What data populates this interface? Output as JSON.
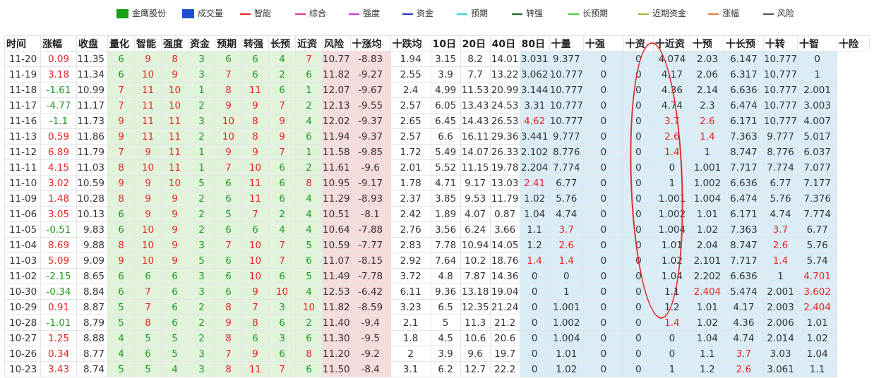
{
  "legend": [
    {
      "label": "金鹰股份",
      "color": "#16a116",
      "style": "box",
      "icon": "green-square"
    },
    {
      "label": "成交量",
      "color": "#1f4fd1",
      "style": "box",
      "icon": "blue-square"
    },
    {
      "label": "智能",
      "color": "#e5262a",
      "style": "line",
      "icon": "red-line"
    },
    {
      "label": "综合",
      "color": "#e0368c",
      "style": "line",
      "icon": "pink-line"
    },
    {
      "label": "强度",
      "color": "#d832d8",
      "style": "line",
      "icon": "magenta-line"
    },
    {
      "label": "资金",
      "color": "#2432c4",
      "style": "line",
      "icon": "navy-line"
    },
    {
      "label": "预期",
      "color": "#32d6d0",
      "style": "line",
      "icon": "cyan-line"
    },
    {
      "label": "转强",
      "color": "#1a6e1a",
      "style": "line",
      "icon": "darkgreen-line"
    },
    {
      "label": "长预期",
      "color": "#3fd63f",
      "style": "line",
      "icon": "lime-line"
    },
    {
      "label": "近期资金",
      "color": "#b4ad2e",
      "style": "line",
      "icon": "olive-line"
    },
    {
      "label": "涨幅",
      "color": "#ef7a3c",
      "style": "line",
      "icon": "orange-line"
    },
    {
      "label": "风险",
      "color": "#6b4a3c",
      "style": "line",
      "icon": "brown-line"
    }
  ],
  "columns": [
    "时间",
    "涨幅",
    "收盘",
    "量化",
    "智能",
    "强度",
    "资金",
    "预期",
    "转强",
    "长预",
    "近资",
    "风险",
    "十涨均",
    "十跌均",
    "10日",
    "20日",
    "40日",
    "80日",
    "十量",
    "十强",
    "十资",
    "十近资",
    "十预",
    "十长预",
    "十转",
    "十智",
    "十险"
  ],
  "rows": [
    {
      "date": "11-20",
      "chg": "0.09",
      "close": "11.35",
      "m": [
        "6",
        "9",
        "8",
        "3",
        "6",
        "6",
        "4",
        "7"
      ],
      "up10": "10.77",
      "dn10": "-8.83",
      "d": [
        "1.94",
        "3.15",
        "8.2",
        "14.01"
      ],
      "t": [
        "3.031",
        "9.377",
        "0",
        "0",
        "4.074",
        "2.03",
        "6.147",
        "10.777",
        "0"
      ],
      "tr": []
    },
    {
      "date": "11-19",
      "chg": "3.18",
      "close": "11.34",
      "m": [
        "6",
        "10",
        "9",
        "3",
        "7",
        "6",
        "2",
        "6"
      ],
      "up10": "11.82",
      "dn10": "-9.27",
      "d": [
        "2.55",
        "3.9",
        "7.7",
        "13.22"
      ],
      "t": [
        "3.062",
        "10.777",
        "0",
        "0",
        "4.17",
        "2.06",
        "6.317",
        "10.777",
        "1"
      ],
      "tr": []
    },
    {
      "date": "11-18",
      "chg": "-1.61",
      "close": "10.99",
      "m": [
        "7",
        "11",
        "10",
        "1",
        "8",
        "11",
        "6",
        "1"
      ],
      "up10": "12.07",
      "dn10": "-9.67",
      "d": [
        "2.4",
        "4.99",
        "11.53",
        "20.99"
      ],
      "t": [
        "3.144",
        "10.777",
        "0",
        "0",
        "4.36",
        "2.14",
        "6.636",
        "10.777",
        "2.001"
      ],
      "tr": []
    },
    {
      "date": "11-17",
      "chg": "-4.77",
      "close": "11.17",
      "m": [
        "7",
        "11",
        "10",
        "2",
        "9",
        "9",
        "7",
        "2"
      ],
      "up10": "12.13",
      "dn10": "-9.55",
      "d": [
        "2.57",
        "6.05",
        "13.43",
        "24.53"
      ],
      "t": [
        "3.31",
        "10.777",
        "0",
        "0",
        "4.74",
        "2.3",
        "6.474",
        "10.777",
        "3.003"
      ],
      "tr": []
    },
    {
      "date": "11-16",
      "chg": "-1.1",
      "close": "11.73",
      "m": [
        "9",
        "11",
        "11",
        "3",
        "10",
        "8",
        "9",
        "4"
      ],
      "up10": "12.02",
      "dn10": "-9.37",
      "d": [
        "2.65",
        "6.45",
        "14.43",
        "26.53"
      ],
      "t": [
        "4.62",
        "10.777",
        "0",
        "0",
        "3.7",
        "2.6",
        "6.171",
        "10.777",
        "4.007"
      ],
      "tr": [
        0,
        4,
        5
      ]
    },
    {
      "date": "11-13",
      "chg": "0.59",
      "close": "11.86",
      "m": [
        "9",
        "11",
        "11",
        "2",
        "10",
        "8",
        "9",
        "6"
      ],
      "up10": "11.94",
      "dn10": "-9.37",
      "d": [
        "2.57",
        "6.6",
        "16.11",
        "29.36"
      ],
      "t": [
        "3.441",
        "9.777",
        "0",
        "0",
        "2.6",
        "1.4",
        "7.363",
        "9.777",
        "5.017"
      ],
      "tr": [
        4,
        5
      ]
    },
    {
      "date": "11-12",
      "chg": "6.89",
      "close": "11.79",
      "m": [
        "7",
        "9",
        "11",
        "1",
        "9",
        "9",
        "7",
        "1"
      ],
      "up10": "11.58",
      "dn10": "-9.85",
      "d": [
        "1.72",
        "5.49",
        "14.07",
        "26.33"
      ],
      "t": [
        "2.102",
        "8.776",
        "0",
        "0",
        "1.4",
        "1",
        "8.747",
        "8.776",
        "6.037"
      ],
      "tr": [
        4
      ]
    },
    {
      "date": "11-11",
      "chg": "4.15",
      "close": "11.03",
      "m": [
        "8",
        "10",
        "11",
        "1",
        "7",
        "10",
        "6",
        "2"
      ],
      "up10": "11.61",
      "dn10": "-9.6",
      "d": [
        "2.01",
        "5.52",
        "11.15",
        "19.78"
      ],
      "t": [
        "2.204",
        "7.774",
        "0",
        "0",
        "0",
        "1.001",
        "7.717",
        "7.774",
        "7.077"
      ],
      "tr": []
    },
    {
      "date": "11-10",
      "chg": "3.02",
      "close": "10.59",
      "m": [
        "9",
        "9",
        "10",
        "5",
        "6",
        "11",
        "6",
        "8"
      ],
      "up10": "10.95",
      "dn10": "-9.17",
      "d": [
        "1.78",
        "4.71",
        "9.17",
        "13.03"
      ],
      "t": [
        "2.41",
        "6.77",
        "0",
        "0",
        "1",
        "1.002",
        "6.636",
        "6.77",
        "7.177"
      ],
      "tr": [
        0
      ]
    },
    {
      "date": "11-09",
      "chg": "1.48",
      "close": "10.28",
      "m": [
        "8",
        "9",
        "9",
        "2",
        "6",
        "11",
        "6",
        "4"
      ],
      "up10": "11.29",
      "dn10": "-8.93",
      "d": [
        "2.37",
        "3.85",
        "9.53",
        "11.79"
      ],
      "t": [
        "1.02",
        "5.76",
        "0",
        "0",
        "1.001",
        "1.004",
        "6.474",
        "5.76",
        "7.376"
      ],
      "tr": []
    },
    {
      "date": "11-06",
      "chg": "3.05",
      "close": "10.13",
      "m": [
        "6",
        "9",
        "9",
        "2",
        "5",
        "7",
        "2",
        "4"
      ],
      "up10": "10.51",
      "dn10": "-8.1",
      "d": [
        "2.42",
        "1.89",
        "4.07",
        "0.87"
      ],
      "t": [
        "1.04",
        "4.74",
        "0",
        "0",
        "1.002",
        "1.01",
        "6.171",
        "4.74",
        "7.774"
      ],
      "tr": []
    },
    {
      "date": "11-05",
      "chg": "-0.51",
      "close": "9.83",
      "m": [
        "6",
        "10",
        "9",
        "2",
        "6",
        "6",
        "4",
        "4"
      ],
      "up10": "10.64",
      "dn10": "-7.88",
      "d": [
        "2.76",
        "3.56",
        "6.24",
        "3.66"
      ],
      "t": [
        "1.1",
        "3.7",
        "0",
        "0",
        "1.004",
        "1.02",
        "7.363",
        "3.7",
        "6.77"
      ],
      "tr": [
        1,
        7
      ]
    },
    {
      "date": "11-04",
      "chg": "8.69",
      "close": "9.88",
      "m": [
        "8",
        "10",
        "9",
        "3",
        "7",
        "10",
        "7",
        "5"
      ],
      "up10": "10.59",
      "dn10": "-7.77",
      "d": [
        "2.83",
        "7.78",
        "10.94",
        "14.05"
      ],
      "t": [
        "1.2",
        "2.6",
        "0",
        "0",
        "1.01",
        "2.04",
        "8.747",
        "2.6",
        "5.76"
      ],
      "tr": [
        1,
        7
      ]
    },
    {
      "date": "11-03",
      "chg": "5.09",
      "close": "9.09",
      "m": [
        "9",
        "10",
        "9",
        "5",
        "6",
        "10",
        "7",
        "6"
      ],
      "up10": "11.07",
      "dn10": "-8.15",
      "d": [
        "2.92",
        "7.64",
        "10.2",
        "18.76"
      ],
      "t": [
        "1.4",
        "1.4",
        "0",
        "0",
        "1.02",
        "2.101",
        "7.717",
        "1.4",
        "5.74"
      ],
      "tr": [
        0,
        1,
        7
      ]
    },
    {
      "date": "11-02",
      "chg": "-2.15",
      "close": "8.65",
      "m": [
        "6",
        "6",
        "6",
        "3",
        "6",
        "10",
        "6",
        "5"
      ],
      "up10": "11.49",
      "dn10": "-7.78",
      "d": [
        "3.72",
        "4.8",
        "7.87",
        "14.36"
      ],
      "t": [
        "0",
        "0",
        "0",
        "0",
        "1.04",
        "2.202",
        "6.636",
        "1",
        "4.701"
      ],
      "tr": [
        8
      ]
    },
    {
      "date": "10-30",
      "chg": "-0.34",
      "close": "8.84",
      "m": [
        "6",
        "7",
        "6",
        "3",
        "6",
        "9",
        "10",
        "4"
      ],
      "up10": "12.53",
      "dn10": "-6.42",
      "d": [
        "6.11",
        "9.36",
        "13.18",
        "19.04"
      ],
      "t": [
        "0",
        "1",
        "0",
        "0",
        "1.1",
        "2.404",
        "5.474",
        "2.001",
        "3.602"
      ],
      "tr": [
        5,
        8
      ]
    },
    {
      "date": "10-29",
      "chg": "0.91",
      "close": "8.87",
      "m": [
        "5",
        "7",
        "6",
        "2",
        "8",
        "7",
        "3",
        "10"
      ],
      "up10": "11.82",
      "dn10": "-8.59",
      "d": [
        "3.23",
        "6.5",
        "12.35",
        "21.24"
      ],
      "t": [
        "0",
        "1.001",
        "0",
        "0",
        "1.2",
        "1.01",
        "4.17",
        "2.003",
        "2.404"
      ],
      "tr": [
        8
      ]
    },
    {
      "date": "10-28",
      "chg": "-1.01",
      "close": "8.79",
      "m": [
        "5",
        "8",
        "6",
        "2",
        "9",
        "8",
        "6",
        "2"
      ],
      "up10": "11.40",
      "dn10": "-9.4",
      "d": [
        "2.1",
        "5",
        "11.3",
        "21.2"
      ],
      "t": [
        "0",
        "1.002",
        "0",
        "0",
        "1.4",
        "1.02",
        "4.36",
        "2.006",
        "1.01"
      ],
      "tr": [
        4
      ]
    },
    {
      "date": "10-27",
      "chg": "1.25",
      "close": "8.88",
      "m": [
        "4",
        "5",
        "5",
        "2",
        "8",
        "6",
        "3",
        "6"
      ],
      "up10": "11.30",
      "dn10": "-9.5",
      "d": [
        "1.8",
        "4.5",
        "10.6",
        "20.6"
      ],
      "t": [
        "0",
        "1.004",
        "0",
        "0",
        "0",
        "1.04",
        "4.74",
        "2.014",
        "1.02"
      ],
      "tr": []
    },
    {
      "date": "10-26",
      "chg": "0.34",
      "close": "8.77",
      "m": [
        "4",
        "6",
        "5",
        "3",
        "7",
        "9",
        "6",
        "8"
      ],
      "up10": "11.20",
      "dn10": "-9.2",
      "d": [
        "2",
        "3.9",
        "9.6",
        "19.7"
      ],
      "t": [
        "0",
        "1.01",
        "0",
        "0",
        "0",
        "1.1",
        "3.7",
        "3.03",
        "1.04"
      ],
      "tr": [
        6
      ]
    },
    {
      "date": "10-23",
      "chg": "3.43",
      "close": "8.74",
      "m": [
        "5",
        "5",
        "4",
        "3",
        "8",
        "11",
        "7",
        "6"
      ],
      "up10": "11.50",
      "dn10": "-8.4",
      "d": [
        "3.1",
        "6.2",
        "12.7",
        "22.2"
      ],
      "t": [
        "0",
        "1.02",
        "0",
        "0",
        "1",
        "1.2",
        "2.6",
        "3.061",
        "1.1"
      ],
      "tr": [
        6
      ]
    }
  ]
}
